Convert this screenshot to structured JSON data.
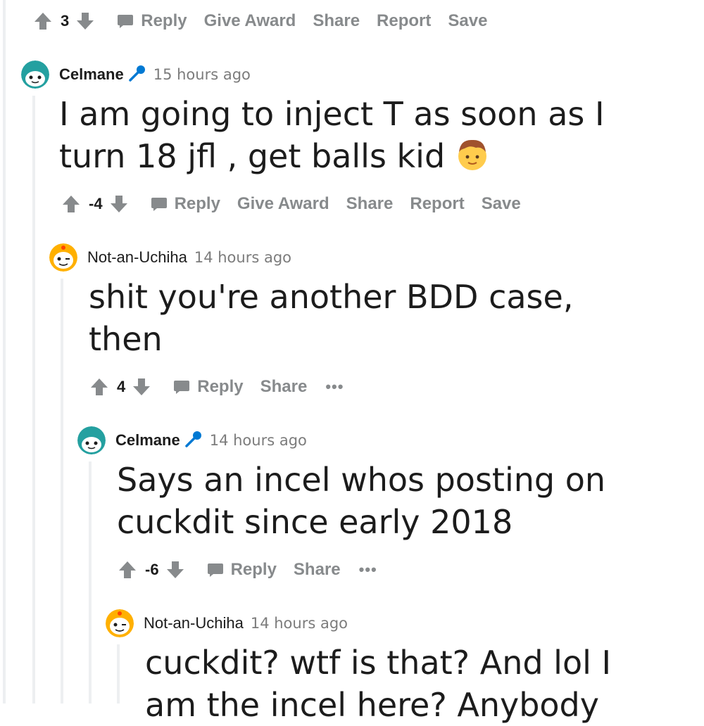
{
  "top_bar": {
    "score": "3",
    "reply": "Reply",
    "give_award": "Give Award",
    "share": "Share",
    "report": "Report",
    "save": "Save"
  },
  "comments": [
    {
      "author": "Celmane",
      "time": "15 hours ago",
      "text": "I am going to inject T as soon as I turn 18 jfl , get balls kid",
      "score": "-4",
      "reply": "Reply",
      "give_award": "Give Award",
      "share": "Share",
      "report": "Report",
      "save": "Save"
    },
    {
      "author": "Not-an-Uchiha",
      "time": "14 hours ago",
      "text_line1": "shit you're another BDD case,",
      "text_line2": "then",
      "score": "4",
      "reply": "Reply",
      "share": "Share",
      "more": "•••"
    },
    {
      "author": "Celmane",
      "time": "14 hours ago",
      "text_line1": "Says an incel whos posting on",
      "text_line2": "cuckdit since early 2018",
      "score": "-6",
      "reply": "Reply",
      "share": "Share",
      "more": "•••"
    },
    {
      "author": "Not-an-Uchiha",
      "time": "14 hours ago",
      "text_line1": "cuckdit? wtf is that? And lol I",
      "text_line2": "am the incel here? Anybody"
    }
  ],
  "colors": {
    "meta_gray": "#878a8c",
    "thread_line": "#edeff1",
    "mic_blue": "#0079d3",
    "avatar_teal": "#24a0a0",
    "avatar_orange": "#ffb000"
  },
  "icons": [
    "upvote-icon",
    "downvote-icon",
    "comment-icon",
    "microphone-icon",
    "boy-emoji"
  ]
}
